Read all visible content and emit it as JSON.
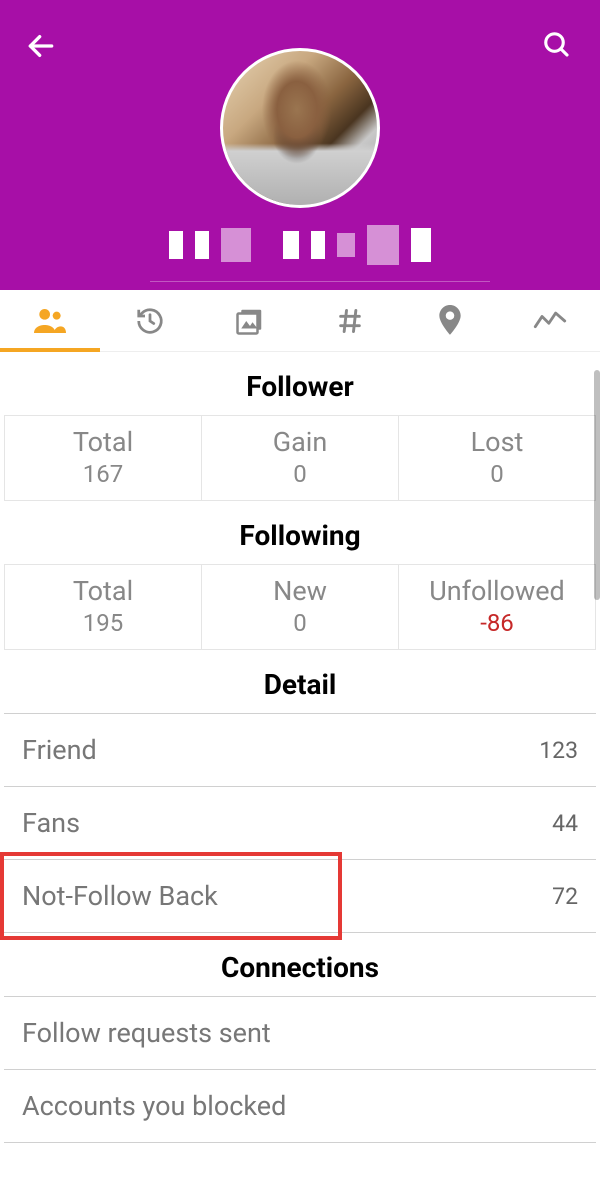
{
  "header": {
    "back_icon": "back-arrow",
    "search_icon": "search"
  },
  "tabs": [
    {
      "name": "people",
      "active": true
    },
    {
      "name": "history",
      "active": false
    },
    {
      "name": "media",
      "active": false
    },
    {
      "name": "hashtag",
      "active": false
    },
    {
      "name": "location",
      "active": false
    },
    {
      "name": "analytics",
      "active": false
    }
  ],
  "follower": {
    "title": "Follower",
    "total_label": "Total",
    "total_value": "167",
    "gain_label": "Gain",
    "gain_value": "0",
    "lost_label": "Lost",
    "lost_value": "0"
  },
  "following": {
    "title": "Following",
    "total_label": "Total",
    "total_value": "195",
    "new_label": "New",
    "new_value": "0",
    "unf_label": "Unfollowed",
    "unf_value": "-86"
  },
  "detail": {
    "title": "Detail",
    "friend_label": "Friend",
    "friend_value": "123",
    "fans_label": "Fans",
    "fans_value": "44",
    "nfb_label": "Not-Follow Back",
    "nfb_value": "72"
  },
  "connections": {
    "title": "Connections",
    "req_label": "Follow requests sent",
    "blk_label": "Accounts you blocked"
  }
}
